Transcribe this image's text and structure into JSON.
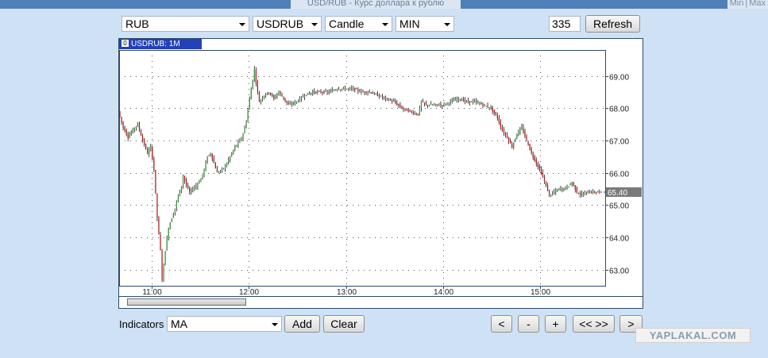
{
  "window": {
    "title": "USD/RUB - Курс доллара к рублю",
    "min_label": "Min",
    "separator": "|",
    "max_label": "Max"
  },
  "toolbar": {
    "currency": "RUB",
    "symbol": "USDRUB",
    "chart_style": "Candle",
    "interval": "MIN",
    "count": "335",
    "refresh_label": "Refresh"
  },
  "chart_label": {
    "index": "0",
    "text": "USDRUB: 1M"
  },
  "chart_data": {
    "type": "candlestick",
    "symbol": "USDRUB",
    "interval": "1M",
    "x_ticks": [
      "11:00",
      "12:00",
      "13:00",
      "14:00",
      "15:00"
    ],
    "y_ticks": [
      "63.00",
      "64.00",
      "65.00",
      "66.00",
      "67.00",
      "68.00",
      "69.00"
    ],
    "ylim": [
      62.5,
      69.8
    ],
    "last_price": "65.40",
    "grid": true,
    "up_color": "#2f8f2f",
    "down_color": "#b01010",
    "path": [
      [
        "10:40",
        67.9
      ],
      [
        "10:43",
        67.4
      ],
      [
        "10:46",
        67.1
      ],
      [
        "10:50",
        67.4
      ],
      [
        "10:52",
        67.5
      ],
      [
        "10:55",
        67.0
      ],
      [
        "10:58",
        66.6
      ],
      [
        "11:00",
        66.8
      ],
      [
        "11:02",
        66.1
      ],
      [
        "11:04",
        64.6
      ],
      [
        "11:06",
        63.6
      ],
      [
        "11:07",
        62.7
      ],
      [
        "11:09",
        63.6
      ],
      [
        "11:11",
        64.3
      ],
      [
        "11:13",
        64.6
      ],
      [
        "11:15",
        64.9
      ],
      [
        "11:17",
        65.3
      ],
      [
        "11:19",
        65.6
      ],
      [
        "11:20",
        65.9
      ],
      [
        "11:22",
        65.6
      ],
      [
        "11:24",
        65.4
      ],
      [
        "11:26",
        65.5
      ],
      [
        "11:28",
        65.6
      ],
      [
        "11:31",
        65.8
      ],
      [
        "11:33",
        66.1
      ],
      [
        "11:35",
        66.5
      ],
      [
        "11:37",
        66.6
      ],
      [
        "11:39",
        66.3
      ],
      [
        "11:41",
        66.0
      ],
      [
        "11:44",
        66.1
      ],
      [
        "11:46",
        66.2
      ],
      [
        "11:49",
        66.5
      ],
      [
        "11:52",
        66.8
      ],
      [
        "11:55",
        67.0
      ],
      [
        "11:57",
        67.2
      ],
      [
        "11:59",
        67.6
      ],
      [
        "12:01",
        68.3
      ],
      [
        "12:03",
        68.9
      ],
      [
        "12:04",
        69.2
      ],
      [
        "12:05",
        68.8
      ],
      [
        "12:07",
        68.2
      ],
      [
        "12:10",
        68.4
      ],
      [
        "12:13",
        68.5
      ],
      [
        "12:16",
        68.3
      ],
      [
        "12:19",
        68.5
      ],
      [
        "12:22",
        68.3
      ],
      [
        "12:25",
        68.1
      ],
      [
        "12:30",
        68.2
      ],
      [
        "12:35",
        68.4
      ],
      [
        "12:40",
        68.5
      ],
      [
        "12:45",
        68.5
      ],
      [
        "12:50",
        68.5
      ],
      [
        "12:55",
        68.6
      ],
      [
        "13:00",
        68.6
      ],
      [
        "13:05",
        68.6
      ],
      [
        "13:10",
        68.5
      ],
      [
        "13:15",
        68.5
      ],
      [
        "13:20",
        68.4
      ],
      [
        "13:25",
        68.3
      ],
      [
        "13:30",
        68.2
      ],
      [
        "13:35",
        68.0
      ],
      [
        "13:40",
        67.9
      ],
      [
        "13:45",
        67.8
      ],
      [
        "13:47",
        68.2
      ],
      [
        "13:50",
        68.1
      ],
      [
        "13:55",
        68.1
      ],
      [
        "14:00",
        68.1
      ],
      [
        "14:05",
        68.2
      ],
      [
        "14:10",
        68.3
      ],
      [
        "14:15",
        68.2
      ],
      [
        "14:20",
        68.2
      ],
      [
        "14:25",
        68.1
      ],
      [
        "14:30",
        68.0
      ],
      [
        "14:34",
        67.7
      ],
      [
        "14:37",
        67.3
      ],
      [
        "14:40",
        67.1
      ],
      [
        "14:43",
        66.8
      ],
      [
        "14:46",
        67.2
      ],
      [
        "14:49",
        67.4
      ],
      [
        "14:52",
        67.0
      ],
      [
        "14:55",
        66.6
      ],
      [
        "14:58",
        66.3
      ],
      [
        "15:01",
        66.0
      ],
      [
        "15:04",
        65.6
      ],
      [
        "15:06",
        65.3
      ],
      [
        "15:09",
        65.4
      ],
      [
        "15:12",
        65.5
      ],
      [
        "15:15",
        65.5
      ],
      [
        "15:18",
        65.6
      ],
      [
        "15:20",
        65.7
      ],
      [
        "15:23",
        65.4
      ],
      [
        "15:26",
        65.3
      ],
      [
        "15:29",
        65.4
      ],
      [
        "15:33",
        65.4
      ],
      [
        "15:37",
        65.4
      ]
    ]
  },
  "indicators": {
    "label": "Indicators",
    "selected": "MA",
    "add_label": "Add",
    "clear_label": "Clear"
  },
  "navigation": {
    "prev": "<",
    "zoom_out": "-",
    "zoom_in": "+",
    "fit": "<< >>",
    "next": ">"
  },
  "watermark": "YAPLAKAL.COM"
}
